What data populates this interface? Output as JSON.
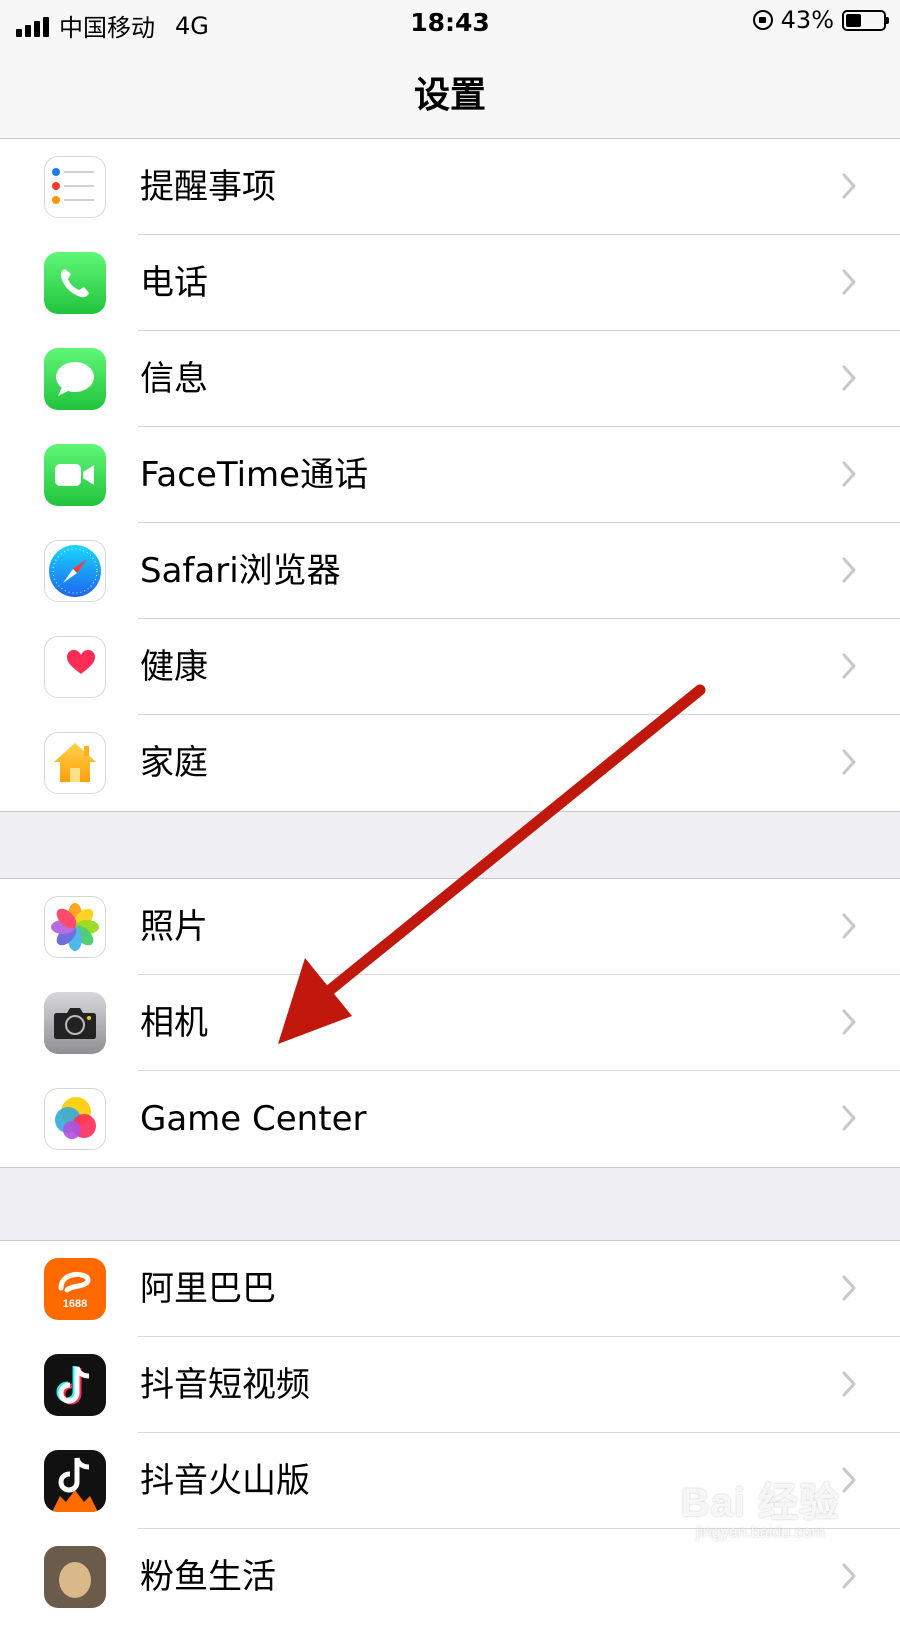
{
  "status_bar": {
    "carrier": "中国移动",
    "network": "4G",
    "time": "18:43",
    "battery_percent_text": "43%",
    "battery_level": 0.43
  },
  "nav": {
    "title": "设置"
  },
  "groups": [
    {
      "items": [
        {
          "label": "提醒事项",
          "icon": "reminders-icon"
        },
        {
          "label": "电话",
          "icon": "phone-icon"
        },
        {
          "label": "信息",
          "icon": "messages-icon"
        },
        {
          "label": "FaceTime通话",
          "icon": "facetime-icon"
        },
        {
          "label": "Safari浏览器",
          "icon": "safari-icon"
        },
        {
          "label": "健康",
          "icon": "health-icon"
        },
        {
          "label": "家庭",
          "icon": "home-icon"
        }
      ]
    },
    {
      "items": [
        {
          "label": "照片",
          "icon": "photos-icon"
        },
        {
          "label": "相机",
          "icon": "camera-icon"
        },
        {
          "label": "Game Center",
          "icon": "game-center-icon"
        }
      ]
    },
    {
      "items": [
        {
          "label": "阿里巴巴",
          "icon": "alibaba-icon",
          "badge": "1688"
        },
        {
          "label": "抖音短视频",
          "icon": "douyin-icon"
        },
        {
          "label": "抖音火山版",
          "icon": "douyin-volcano-icon"
        },
        {
          "label": "粉鱼生活",
          "icon": "app-icon"
        }
      ]
    }
  ],
  "watermark": {
    "logo": "Bai 经验",
    "url": "jingyan.baidu.com"
  },
  "colors": {
    "arrow": "#c0180c",
    "chevron": "#c7c7cc",
    "separator": "#d8d8dc"
  }
}
